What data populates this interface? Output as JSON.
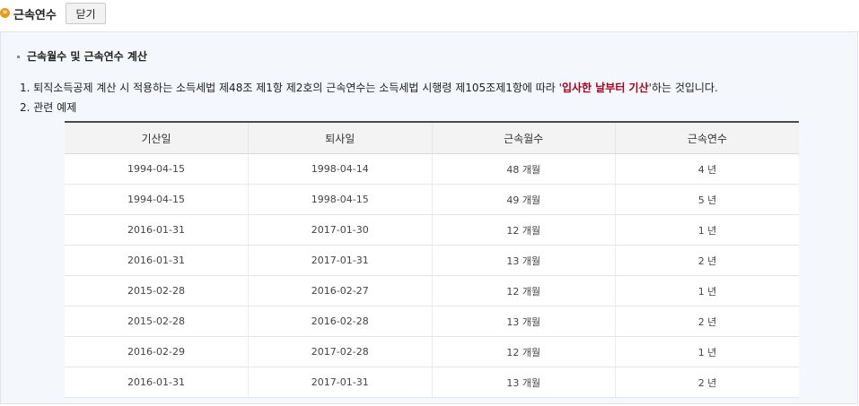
{
  "header": {
    "title": "근속연수",
    "close_label": "닫기",
    "icon_glyph": "»"
  },
  "section": {
    "title": "근속월수 및 근속연수 계산",
    "line1_before": "1. 퇴직소득공제 계산 시 적용하는 소득세법 제48조 제1항 제2호의 근속연수는 소득세법 시행령 제105조제1항에 따라 '",
    "line1_highlight": "입사한 날부터 기산",
    "line1_after": "'하는 것입니다.",
    "line2": "2. 관련 예제"
  },
  "table": {
    "headers": [
      "기산일",
      "퇴사일",
      "근속월수",
      "근속연수"
    ],
    "rows": [
      [
        "1994-04-15",
        "1998-04-14",
        "48 개월",
        "4 년"
      ],
      [
        "1994-04-15",
        "1998-04-15",
        "49 개월",
        "5 년"
      ],
      [
        "2016-01-31",
        "2017-01-30",
        "12 개월",
        "1 년"
      ],
      [
        "2016-01-31",
        "2017-01-31",
        "13 개월",
        "2 년"
      ],
      [
        "2015-02-28",
        "2016-02-27",
        "12 개월",
        "1 년"
      ],
      [
        "2015-02-28",
        "2016-02-28",
        "13 개월",
        "2 년"
      ],
      [
        "2016-02-29",
        "2017-02-28",
        "12 개월",
        "1 년"
      ],
      [
        "2016-01-31",
        "2017-01-31",
        "13 개월",
        "2 년"
      ]
    ]
  },
  "colors": {
    "accent_orange": "#e89a1c",
    "highlight_red": "#a3001c",
    "panel_bg": "#f4f7fb"
  }
}
